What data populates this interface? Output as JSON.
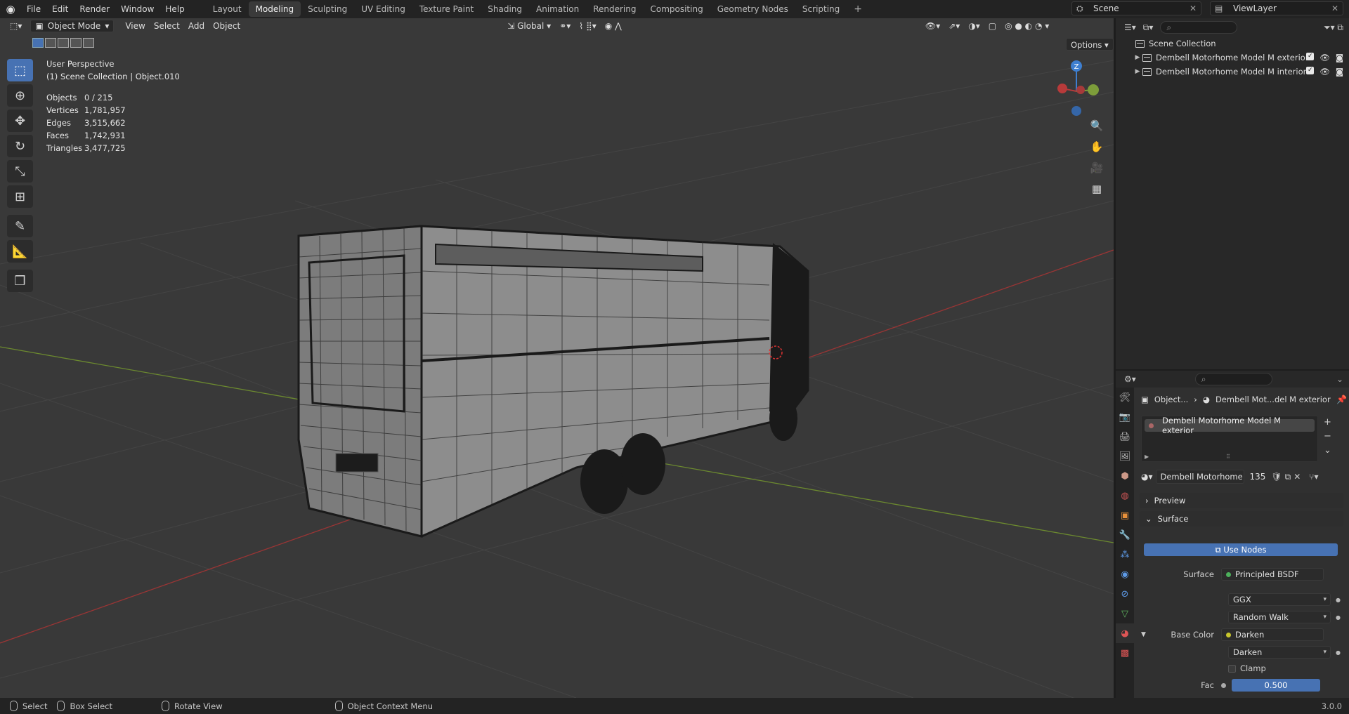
{
  "topbar": {
    "menu": [
      "File",
      "Edit",
      "Render",
      "Window",
      "Help"
    ],
    "workspaces": [
      "Layout",
      "Modeling",
      "Sculpting",
      "UV Editing",
      "Texture Paint",
      "Shading",
      "Animation",
      "Rendering",
      "Compositing",
      "Geometry Nodes",
      "Scripting"
    ],
    "active_workspace": "Modeling",
    "add_tab": "+",
    "scene": "Scene",
    "view_layer": "ViewLayer"
  },
  "viewport": {
    "mode": "Object Mode",
    "menus": [
      "View",
      "Select",
      "Add",
      "Object"
    ],
    "transform_orientation": "Global",
    "options_label": "Options",
    "perspective": "User Perspective",
    "collection_info": "(1) Scene Collection | Object.010",
    "stats": [
      {
        "label": "Objects",
        "value": "0 / 215"
      },
      {
        "label": "Vertices",
        "value": "1,781,957"
      },
      {
        "label": "Edges",
        "value": "3,515,662"
      },
      {
        "label": "Faces",
        "value": "1,742,931"
      },
      {
        "label": "Triangles",
        "value": "3,477,725"
      }
    ],
    "gizmo_z": "Z",
    "colors": {
      "x_axis": "#b83a3a",
      "y_axis": "#7d9d3a",
      "z_axis": "#3e7fd0",
      "bg": "#393939"
    }
  },
  "outliner": {
    "root": "Scene Collection",
    "items": [
      "Dembell Motorhome Model M exterior",
      "Dembell Motorhome Model M  interior"
    ]
  },
  "properties": {
    "breadcrumb_object": "Object...",
    "breadcrumb_material": "Dembell Mot...del M exterior",
    "slot": "Dembell Motorhome Model M exterior",
    "material_name": "Dembell Motorhome ...",
    "users": "135",
    "preview_panel": "Preview",
    "surface_panel": "Surface",
    "use_nodes": "Use Nodes",
    "surface_label": "Surface",
    "surface_value": "Principled BSDF",
    "distribution": "GGX",
    "subsurface": "Random Walk",
    "base_color_label": "Base Color",
    "base_color_value": "Darken",
    "blend_mode": "Darken",
    "clamp": "Clamp",
    "fac_label": "Fac",
    "fac_value": "0.500"
  },
  "status": {
    "select": "Select",
    "box_select": "Box Select",
    "rotate_view": "Rotate View",
    "context_menu": "Object Context Menu",
    "version": "3.0.0"
  }
}
